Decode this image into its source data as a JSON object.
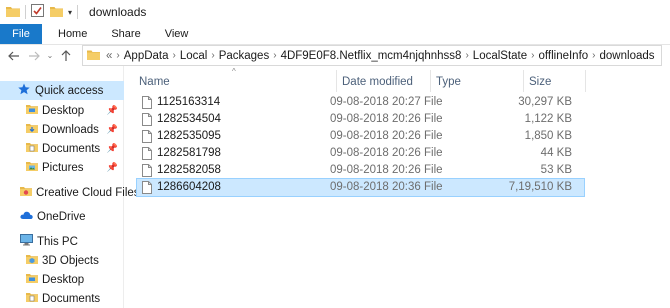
{
  "window": {
    "title": "downloads"
  },
  "ribbon": {
    "tabs": [
      "File",
      "Home",
      "Share",
      "View"
    ]
  },
  "address": {
    "overflow": "«",
    "crumbs": [
      "AppData",
      "Local",
      "Packages",
      "4DF9E0F8.Netflix_mcm4njqhnhss8",
      "LocalState",
      "offlineInfo",
      "downloads"
    ]
  },
  "sidebar": {
    "items": [
      {
        "label": "Quick access",
        "icon": "star-icon",
        "pinned": false,
        "selected": true
      },
      {
        "label": "Desktop",
        "icon": "folder-icon",
        "pinned": true
      },
      {
        "label": "Downloads",
        "icon": "downloads-folder-icon",
        "pinned": true
      },
      {
        "label": "Documents",
        "icon": "documents-folder-icon",
        "pinned": true
      },
      {
        "label": "Pictures",
        "icon": "pictures-folder-icon",
        "pinned": true
      },
      {
        "label": "Creative Cloud Files",
        "icon": "creative-cloud-icon",
        "pinned": false
      },
      {
        "label": "OneDrive",
        "icon": "onedrive-icon",
        "pinned": false
      },
      {
        "label": "This PC",
        "icon": "computer-icon",
        "pinned": false
      },
      {
        "label": "3D Objects",
        "icon": "3d-objects-folder-icon",
        "pinned": false
      },
      {
        "label": "Desktop",
        "icon": "folder-icon",
        "pinned": false
      },
      {
        "label": "Documents",
        "icon": "documents-folder-icon",
        "pinned": false
      }
    ]
  },
  "columns": {
    "name": "Name",
    "date": "Date modified",
    "type": "Type",
    "size": "Size"
  },
  "files": [
    {
      "name": "1125163314",
      "date": "09-08-2018 20:27",
      "type": "File",
      "size": "30,297 KB"
    },
    {
      "name": "1282534504",
      "date": "09-08-2018 20:26",
      "type": "File",
      "size": "1,122 KB"
    },
    {
      "name": "1282535095",
      "date": "09-08-2018 20:26",
      "type": "File",
      "size": "1,850 KB"
    },
    {
      "name": "1282581798",
      "date": "09-08-2018 20:26",
      "type": "File",
      "size": "44 KB"
    },
    {
      "name": "1282582058",
      "date": "09-08-2018 20:26",
      "type": "File",
      "size": "53 KB"
    },
    {
      "name": "1286604208",
      "date": "09-08-2018 20:36",
      "type": "File",
      "size": "7,19,510 KB",
      "selected": true
    }
  ],
  "colors": {
    "accent": "#1979ca",
    "selection": "#cce8ff",
    "header_text": "#4c607a",
    "folder": "#e8b94a"
  }
}
